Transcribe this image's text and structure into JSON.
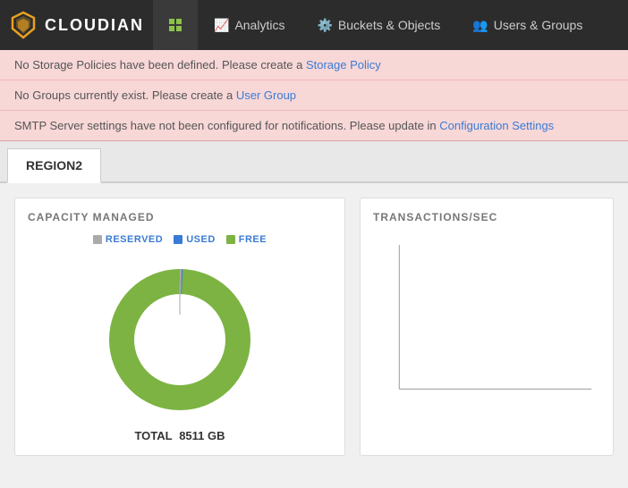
{
  "header": {
    "logo_text": "CLOUDIAN",
    "nav_items": [
      {
        "id": "dashboard",
        "label": "",
        "icon": "grid",
        "active": true
      },
      {
        "id": "analytics",
        "label": "Analytics",
        "icon": "chart",
        "active": false
      },
      {
        "id": "buckets",
        "label": "Buckets & Objects",
        "icon": "gear",
        "active": false
      },
      {
        "id": "users",
        "label": "Users & Groups",
        "icon": "people",
        "active": false
      }
    ]
  },
  "alerts": [
    {
      "text_before": "No Storage Policies have been defined. Please create a ",
      "link_text": "Storage Policy",
      "text_after": ""
    },
    {
      "text_before": "No Groups currently exist. Please create a ",
      "link_text": "User Group",
      "text_after": ""
    },
    {
      "text_before": "SMTP Server settings have not been configured for notifications. Please update in ",
      "link_text": "Configuration Settings",
      "text_after": ""
    }
  ],
  "tabs": [
    {
      "id": "region2",
      "label": "REGION2",
      "active": true
    }
  ],
  "capacity_card": {
    "title": "CAPACITY MANAGED",
    "legend": {
      "reserved": "RESERVED",
      "used": "USED",
      "free": "FREE"
    },
    "total_label": "TOTAL",
    "total_value": "8511 GB",
    "donut": {
      "free_pct": 98,
      "used_pct": 0.5,
      "reserved_pct": 1.5
    }
  },
  "transactions_card": {
    "title": "TRANSACTIONS/SEC"
  }
}
